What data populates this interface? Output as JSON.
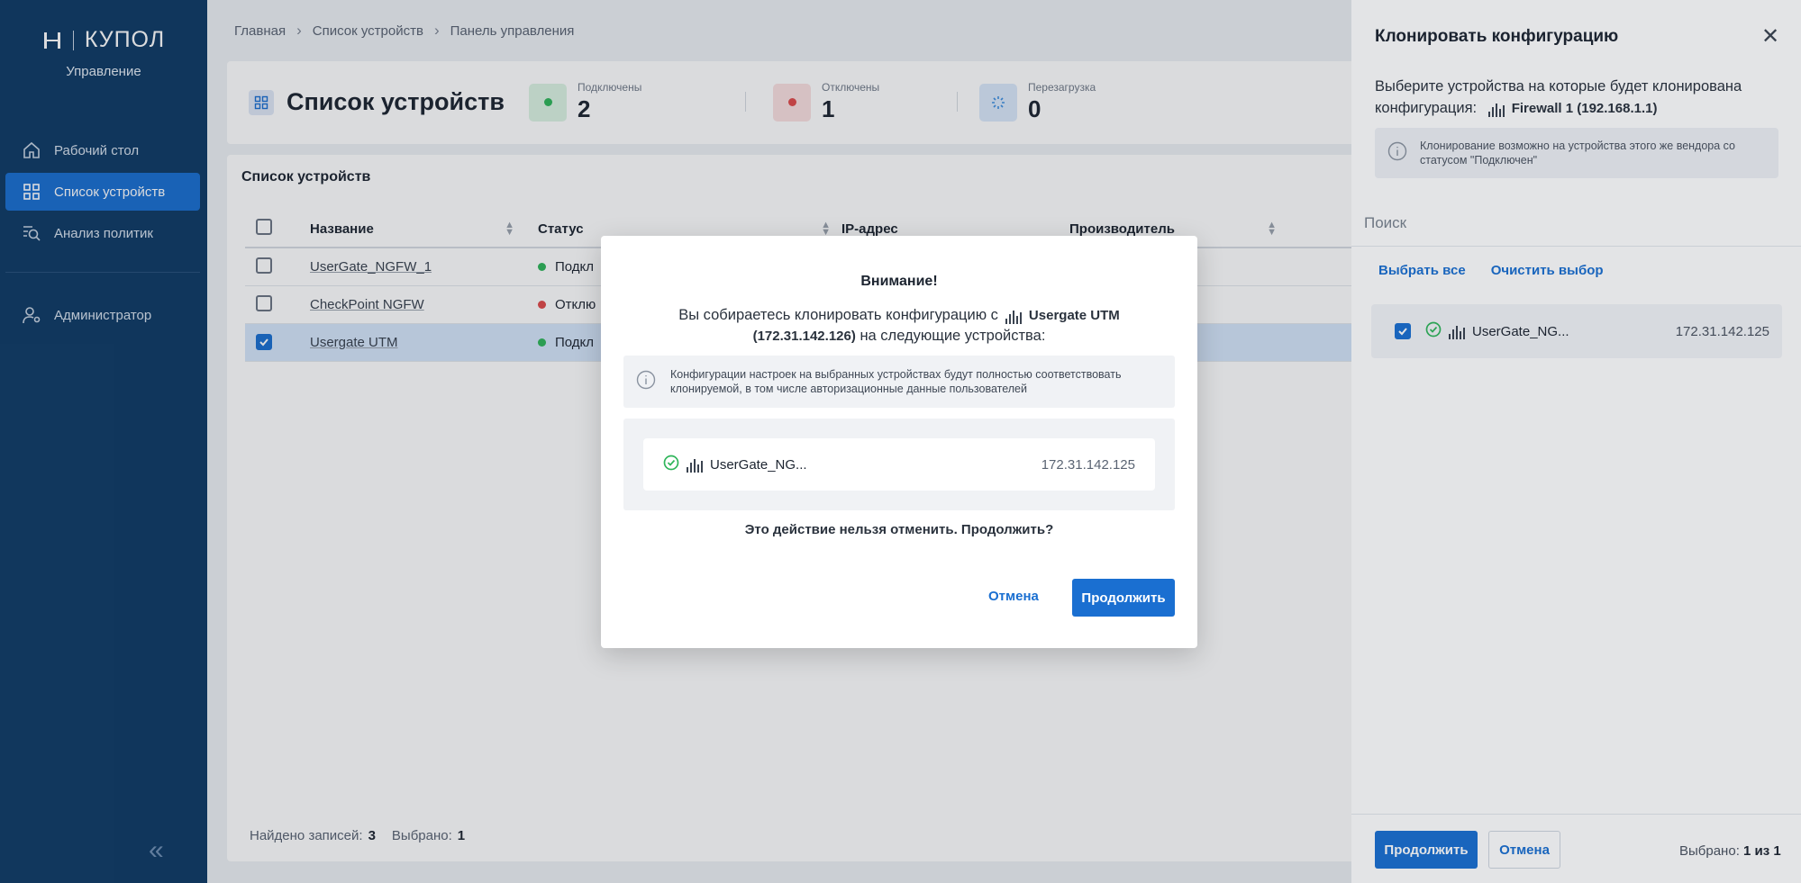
{
  "sidebar": {
    "logo": "КУПОЛ",
    "subtitle": "Управление",
    "items": [
      {
        "label": "Рабочий стол"
      },
      {
        "label": "Список устройств"
      },
      {
        "label": "Анализ политик"
      },
      {
        "label": "Администратор"
      }
    ],
    "collapse_icon": "«"
  },
  "breadcrumb": [
    "Главная",
    "Список устройств",
    "Панель управления"
  ],
  "header": {
    "title": "Список устройств",
    "stats": [
      {
        "label": "Подключены",
        "value": "2",
        "color": "#2fb55a"
      },
      {
        "label": "Отключены",
        "value": "1",
        "color": "#e04b4b"
      },
      {
        "label": "Перезагрузка",
        "value": "0",
        "color": "#3d8fe0"
      }
    ]
  },
  "device_list": {
    "title": "Список устройств",
    "columns": [
      "Название",
      "Статус",
      "IP-адрес",
      "Производитель"
    ],
    "rows": [
      {
        "name": "UserGate_NGFW_1",
        "status": "Подкл",
        "status_color": "#2fb55a"
      },
      {
        "name": "CheckPoint NGFW",
        "status": "Отклю",
        "status_color": "#e04b4b"
      },
      {
        "name": "Usergate UTM",
        "status": "Подкл",
        "status_color": "#2fb55a"
      }
    ],
    "footer": {
      "found_label": "Найдено записей:",
      "found_value": "3",
      "selected_label": "Выбрано:",
      "selected_value": "1"
    }
  },
  "panel": {
    "title": "Клонировать конфигурацию",
    "close_icon": "✕",
    "desc_prefix": "Выберите устройства на которые будет клонирована конфигурация:",
    "device": "Firewall 1 (192.168.1.1)",
    "info": "Клонирование возможно на устройства этого же вендора со статусом \"Подключен\"",
    "search_placeholder": "Поиск",
    "select_all": "Выбрать все",
    "clear": "Очистить выбор",
    "item": {
      "name": "UserGate_NG...",
      "ip": "172.31.142.125"
    },
    "continue": "Продолжить",
    "cancel": "Отмена",
    "selected_label": "Выбрано:",
    "selected_value": "1 из 1"
  },
  "modal": {
    "title": "Внимание!",
    "text_prefix": "Вы собираетесь клонировать конфигурацию с",
    "source_device": "Usergate UTM",
    "source_ip": "(172.31.142.126)",
    "text_suffix": "на следующие устройства:",
    "info": "Конфигурации настроек на выбранных устройствах будут полностью соответствовать клонируемой, в том числе авторизационные данные пользователей",
    "item": {
      "name": "UserGate_NG...",
      "ip": "172.31.142.125"
    },
    "warning": "Это действие нельзя отменить. Продолжить?",
    "cancel": "Отмена",
    "continue": "Продолжить"
  }
}
